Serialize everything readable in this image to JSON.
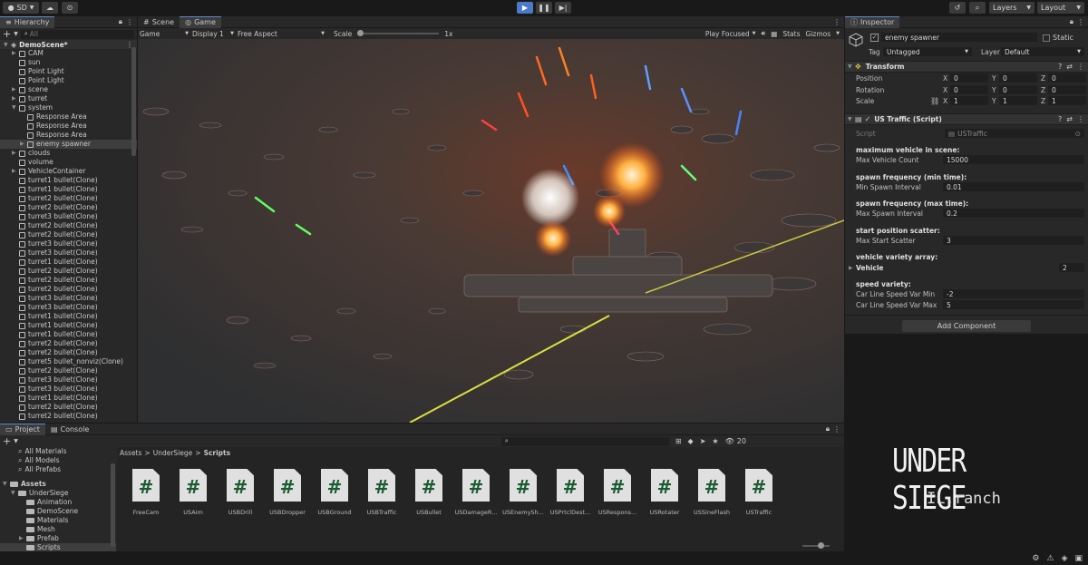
{
  "toolbar": {
    "account": "SD",
    "layers": "Layers",
    "layout": "Layout"
  },
  "hierarchy": {
    "tab": "Hierarchy",
    "search_placeholder": "All",
    "scene": "DemoScene*",
    "items": [
      {
        "label": "CAM",
        "depth": 1,
        "arrow": true
      },
      {
        "label": "sun",
        "depth": 1,
        "arrow": false
      },
      {
        "label": "Point Light",
        "depth": 1,
        "arrow": false
      },
      {
        "label": "Point Light",
        "depth": 1,
        "arrow": false
      },
      {
        "label": "scene",
        "depth": 1,
        "arrow": true
      },
      {
        "label": "turret",
        "depth": 1,
        "arrow": true
      },
      {
        "label": "system",
        "depth": 1,
        "arrow": true,
        "open": true
      },
      {
        "label": "Response Area",
        "depth": 2,
        "arrow": false
      },
      {
        "label": "Response Area",
        "depth": 2,
        "arrow": false
      },
      {
        "label": "Response Area",
        "depth": 2,
        "arrow": false
      },
      {
        "label": "enemy spawner",
        "depth": 2,
        "arrow": true,
        "selected": true
      },
      {
        "label": "clouds",
        "depth": 1,
        "arrow": true
      },
      {
        "label": "volume",
        "depth": 1,
        "arrow": false
      },
      {
        "label": "VehicleContainer",
        "depth": 1,
        "arrow": true
      },
      {
        "label": "turret1 bullet(Clone)",
        "depth": 1
      },
      {
        "label": "turret1 bullet(Clone)",
        "depth": 1
      },
      {
        "label": "turret2 bullet(Clone)",
        "depth": 1
      },
      {
        "label": "turret2 bullet(Clone)",
        "depth": 1
      },
      {
        "label": "turret3 bullet(Clone)",
        "depth": 1
      },
      {
        "label": "turret2 bullet(Clone)",
        "depth": 1
      },
      {
        "label": "turret2 bullet(Clone)",
        "depth": 1
      },
      {
        "label": "turret3 bullet(Clone)",
        "depth": 1
      },
      {
        "label": "turret3 bullet(Clone)",
        "depth": 1
      },
      {
        "label": "turret1 bullet(Clone)",
        "depth": 1
      },
      {
        "label": "turret2 bullet(Clone)",
        "depth": 1
      },
      {
        "label": "turret2 bullet(Clone)",
        "depth": 1
      },
      {
        "label": "turret2 bullet(Clone)",
        "depth": 1
      },
      {
        "label": "turret3 bullet(Clone)",
        "depth": 1
      },
      {
        "label": "turret3 bullet(Clone)",
        "depth": 1
      },
      {
        "label": "turret1 bullet(Clone)",
        "depth": 1
      },
      {
        "label": "turret1 bullet(Clone)",
        "depth": 1
      },
      {
        "label": "turret1 bullet(Clone)",
        "depth": 1
      },
      {
        "label": "turret2 bullet(Clone)",
        "depth": 1
      },
      {
        "label": "turret2 bullet(Clone)",
        "depth": 1
      },
      {
        "label": "turret5 bullet_nonviz(Clone)",
        "depth": 1
      },
      {
        "label": "turret2 bullet(Clone)",
        "depth": 1
      },
      {
        "label": "turret3 bullet(Clone)",
        "depth": 1
      },
      {
        "label": "turret3 bullet(Clone)",
        "depth": 1
      },
      {
        "label": "turret1 bullet(Clone)",
        "depth": 1
      },
      {
        "label": "turret2 bullet(Clone)",
        "depth": 1
      },
      {
        "label": "turret2 bullet(Clone)",
        "depth": 1
      }
    ]
  },
  "view": {
    "tab_scene": "Scene",
    "tab_game": "Game",
    "mode": "Game",
    "display": "Display 1",
    "aspect": "Free Aspect",
    "scale_label": "Scale",
    "scale_value": "1x",
    "play_focused": "Play Focused",
    "stats": "Stats",
    "gizmos": "Gizmos"
  },
  "inspector": {
    "tab": "Inspector",
    "object_name": "enemy spawner",
    "static": "Static",
    "tag_label": "Tag",
    "tag_value": "Untagged",
    "layer_label": "Layer",
    "layer_value": "Default",
    "transform": {
      "title": "Transform",
      "rows": [
        {
          "label": "Position",
          "x": "0",
          "y": "0",
          "z": "0"
        },
        {
          "label": "Rotation",
          "x": "0",
          "y": "0",
          "z": "0"
        },
        {
          "label": "Scale",
          "x": "1",
          "y": "1",
          "z": "1"
        }
      ],
      "x": "X",
      "y": "Y",
      "z": "Z"
    },
    "script_comp": {
      "title": "US Traffic (Script)",
      "script_label": "Script",
      "script_value": "USTraffic",
      "groups": [
        {
          "header": "maximum vehicle in scene:",
          "label": "Max Vehicle Count",
          "value": "15000"
        },
        {
          "header": "spawn frequency (min time):",
          "label": "Min Spawn Interval",
          "value": "0.01"
        },
        {
          "header": "spawn frequency (max time):",
          "label": "Max Spawn Interval",
          "value": "0.2"
        },
        {
          "header": "start position scatter:",
          "label": "Max Start Scatter",
          "value": "3"
        }
      ],
      "array_header": "vehicle variety array:",
      "array_label": "Vehicle",
      "array_count": "2",
      "speed_header": "speed variety:",
      "speed_min_label": "Car Line Speed Var Min",
      "speed_min": "-2",
      "speed_max_label": "Car Line Speed Var Max",
      "speed_max": "5"
    },
    "add_component": "Add Component"
  },
  "project": {
    "tab_project": "Project",
    "tab_console": "Console",
    "hidden_count": "20",
    "favorites": [
      "All Materials",
      "All Models",
      "All Prefabs"
    ],
    "assets_root": "Assets",
    "tree": [
      {
        "label": "UnderSiege",
        "depth": 1,
        "arrow": true
      },
      {
        "label": "Animation",
        "depth": 2
      },
      {
        "label": "DemoScene",
        "depth": 2
      },
      {
        "label": "Materials",
        "depth": 2
      },
      {
        "label": "Mesh",
        "depth": 2
      },
      {
        "label": "Prefab",
        "depth": 2,
        "arrow": true
      },
      {
        "label": "Scripts",
        "depth": 2,
        "selected": true
      }
    ],
    "breadcrumb": [
      "Assets",
      "UnderSiege",
      "Scripts"
    ],
    "files": [
      "FreeCam",
      "USAim",
      "USBDrill",
      "USBDropper",
      "USBGround",
      "USBTraffic",
      "USBullet",
      "USDamageR...",
      "USEnemySh...",
      "USPrtclDest...",
      "USRespons...",
      "USRotater",
      "USSineFlash",
      "USTraffic"
    ]
  },
  "branding": {
    "title": "UNDER SIEGE",
    "subtitle": "IL.ranch"
  },
  "colors": {
    "accent": "#5a8ad6",
    "panel": "#282828",
    "dark": "#191919"
  }
}
